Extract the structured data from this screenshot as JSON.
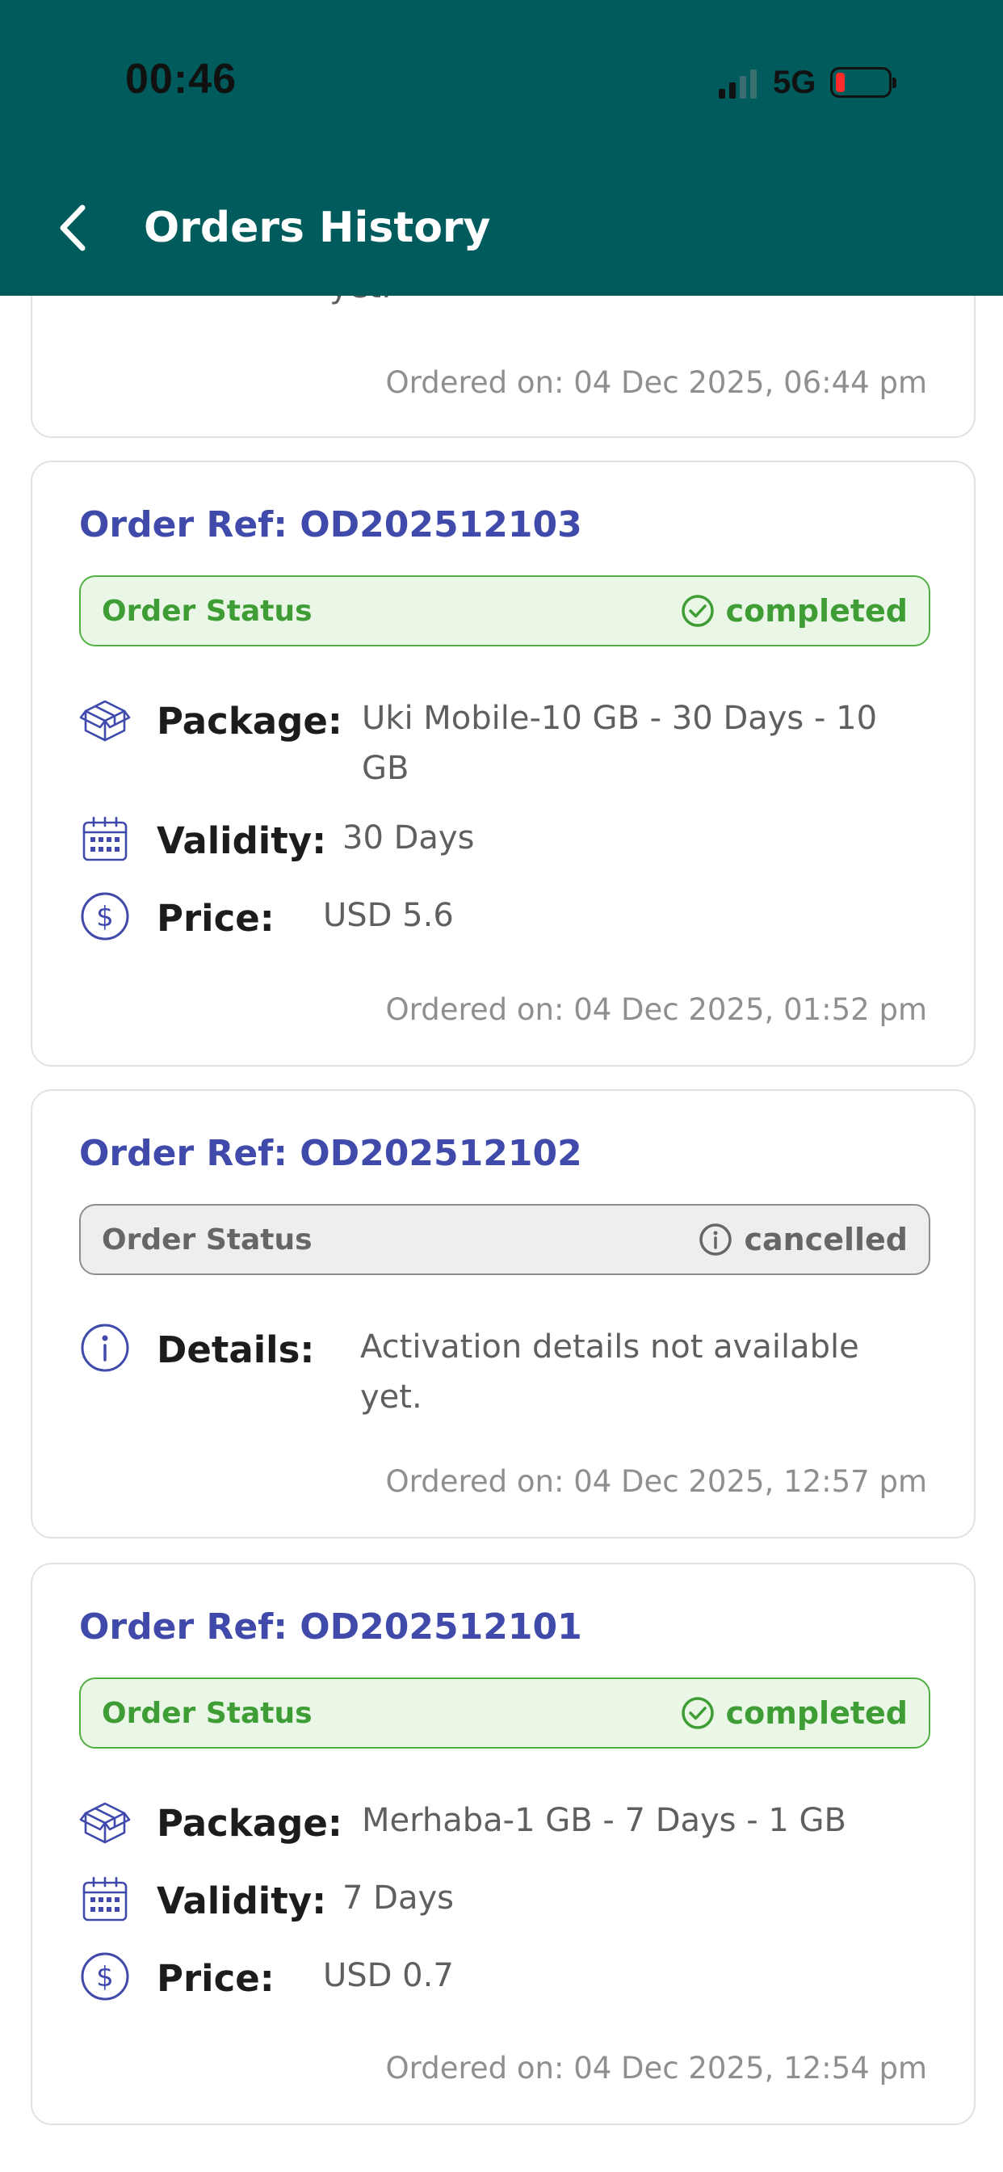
{
  "status_bar": {
    "time": "00:46",
    "network": "5G"
  },
  "header": {
    "title": "Orders History"
  },
  "top_card": {
    "details_tail": "yet.",
    "ordered_on": "Ordered on: 04 Dec 2025, 06:44 pm"
  },
  "orders": [
    {
      "ref": "Order Ref: OD202512103",
      "status_label": "Order Status",
      "status_value": "completed",
      "package_label": "Package:",
      "package_value": "Uki Mobile-10 GB - 30 Days - 10 GB",
      "validity_label": "Validity:",
      "validity_value": "30 Days",
      "price_label": "Price:",
      "price_value": "USD 5.6",
      "ordered_on": "Ordered on: 04 Dec 2025, 01:52 pm"
    },
    {
      "ref": "Order Ref: OD202512102",
      "status_label": "Order Status",
      "status_value": "cancelled",
      "details_label": "Details:",
      "details_value": "Activation details not available yet.",
      "ordered_on": "Ordered on: 04 Dec 2025, 12:57 pm"
    },
    {
      "ref": "Order Ref: OD202512101",
      "status_label": "Order Status",
      "status_value": "completed",
      "package_label": "Package:",
      "package_value": "Merhaba-1 GB - 7 Days - 1 GB",
      "validity_label": "Validity:",
      "validity_value": "7 Days",
      "price_label": "Price:",
      "price_value": "USD 0.7",
      "ordered_on": "Ordered on: 04 Dec 2025, 12:54 pm"
    }
  ],
  "icons": {
    "back": "chevron-left-icon",
    "package": "package-box-icon",
    "validity": "calendar-icon",
    "price": "dollar-circle-icon",
    "details": "info-circle-icon",
    "completed": "check-circle-icon",
    "cancelled": "info-circle-icon"
  },
  "colors": {
    "header_bg": "#005c5c",
    "accent_blue": "#3f4aab",
    "completed_green": "#3e9d34",
    "cancelled_gray": "#666666"
  }
}
